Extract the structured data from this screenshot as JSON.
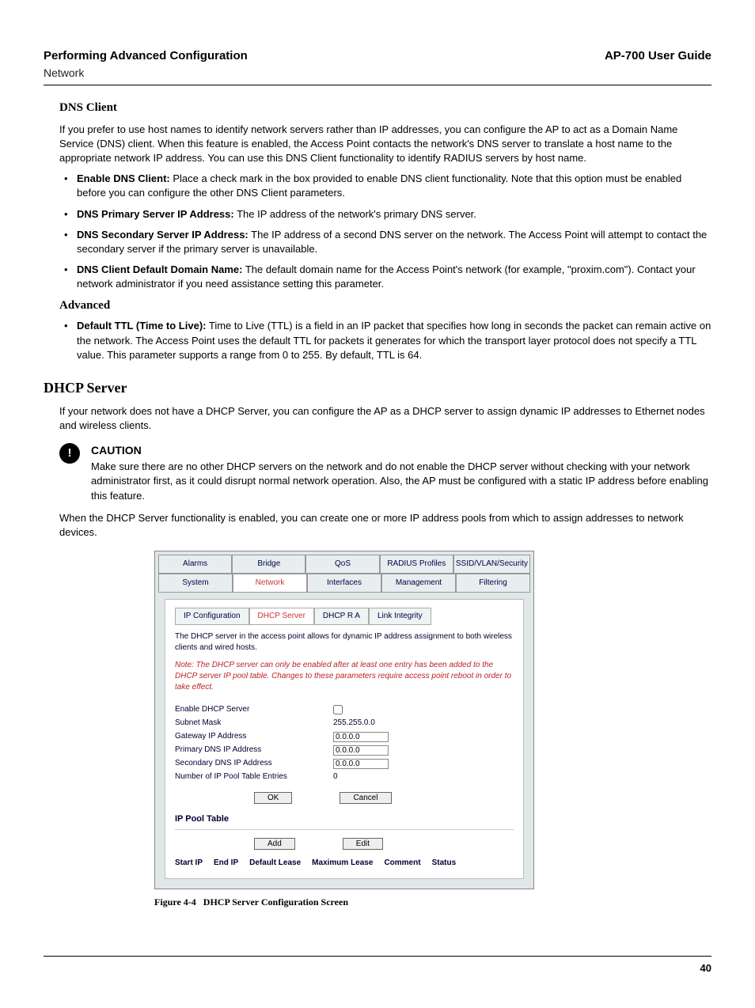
{
  "header": {
    "left": "Performing Advanced Configuration",
    "right": "AP-700 User Guide",
    "sub": "Network"
  },
  "dns": {
    "title": "DNS Client",
    "intro": "If you prefer to use host names to identify network servers rather than IP addresses, you can configure the AP to act as a Domain Name Service (DNS) client. When this feature is enabled, the Access Point contacts the network's DNS server to translate a host name to the appropriate network IP address. You can use this DNS Client functionality to identify RADIUS servers by host name.",
    "items": [
      {
        "b": "Enable DNS Client:",
        "t": " Place a check mark in the box provided to enable DNS client functionality. Note that this option must be enabled before you can configure the other DNS Client parameters."
      },
      {
        "b": "DNS Primary Server IP Address:",
        "t": " The IP address of the network's primary DNS server."
      },
      {
        "b": "DNS Secondary Server IP Address:",
        "t": " The IP address of a second DNS server on the network. The Access Point will attempt to contact the secondary server if the primary server is unavailable."
      },
      {
        "b": "DNS Client Default Domain Name:",
        "t": " The default domain name for the Access Point's network (for example, \"proxim.com\"). Contact your network administrator if you need assistance setting this parameter."
      }
    ]
  },
  "advanced": {
    "title": "Advanced",
    "items": [
      {
        "b": "Default TTL (Time to Live):",
        "t": " Time to Live (TTL) is a field in an IP packet that specifies how long in seconds the packet can remain active on the network. The Access Point uses the default TTL for packets it generates for which the transport layer protocol does not specify a TTL value. This parameter supports a range from 0 to 255. By default, TTL is 64."
      }
    ]
  },
  "dhcp": {
    "title": "DHCP Server",
    "intro": "If your network does not have a DHCP Server, you can configure the AP as a DHCP server to assign dynamic IP addresses to Ethernet nodes and wireless clients.",
    "caution_h": "CAUTION",
    "caution_t": "Make sure there are no other DHCP servers on the network and do not enable the DHCP server without checking with your network administrator first, as it could disrupt normal network operation. Also, the AP must be configured with a static IP address before enabling this feature.",
    "after": "When the DHCP Server functionality is enabled, you can create one or more IP address pools from which to assign addresses to network devices."
  },
  "figure": {
    "tabs_top": [
      "Alarms",
      "Bridge",
      "QoS",
      "RADIUS Profiles",
      "SSID/VLAN/Security"
    ],
    "tabs_bot": [
      "System",
      "Network",
      "Interfaces",
      "Management",
      "Filtering"
    ],
    "subtabs": [
      "IP Configuration",
      "DHCP Server",
      "DHCP R A",
      "Link Integrity"
    ],
    "desc": "The DHCP server in the access point allows for dynamic IP address assignment to both wireless clients and wired hosts.",
    "note": "Note: The DHCP server can only be enabled after at least one entry has been added to the DHCP server IP pool table. Changes to these parameters require access point reboot in order to take effect.",
    "rows": {
      "enable": "Enable DHCP Server",
      "subnet_l": "Subnet Mask",
      "subnet_v": "255.255.0.0",
      "gw_l": "Gateway IP Address",
      "gw_v": "0.0.0.0",
      "pdns_l": "Primary DNS IP Address",
      "pdns_v": "0.0.0.0",
      "sdns_l": "Secondary DNS IP Address",
      "sdns_v": "0.0.0.0",
      "pool_l": "Number of IP Pool Table Entries",
      "pool_v": "0"
    },
    "ok": "OK",
    "cancel": "Cancel",
    "pool_title": "IP Pool Table",
    "add": "Add",
    "edit": "Edit",
    "pool_headers": [
      "Start IP",
      "End IP",
      "Default Lease",
      "Maximum Lease",
      "Comment",
      "Status"
    ],
    "caption_label": "Figure 4-4",
    "caption_text": "DHCP Server Configuration Screen"
  },
  "page": "40"
}
